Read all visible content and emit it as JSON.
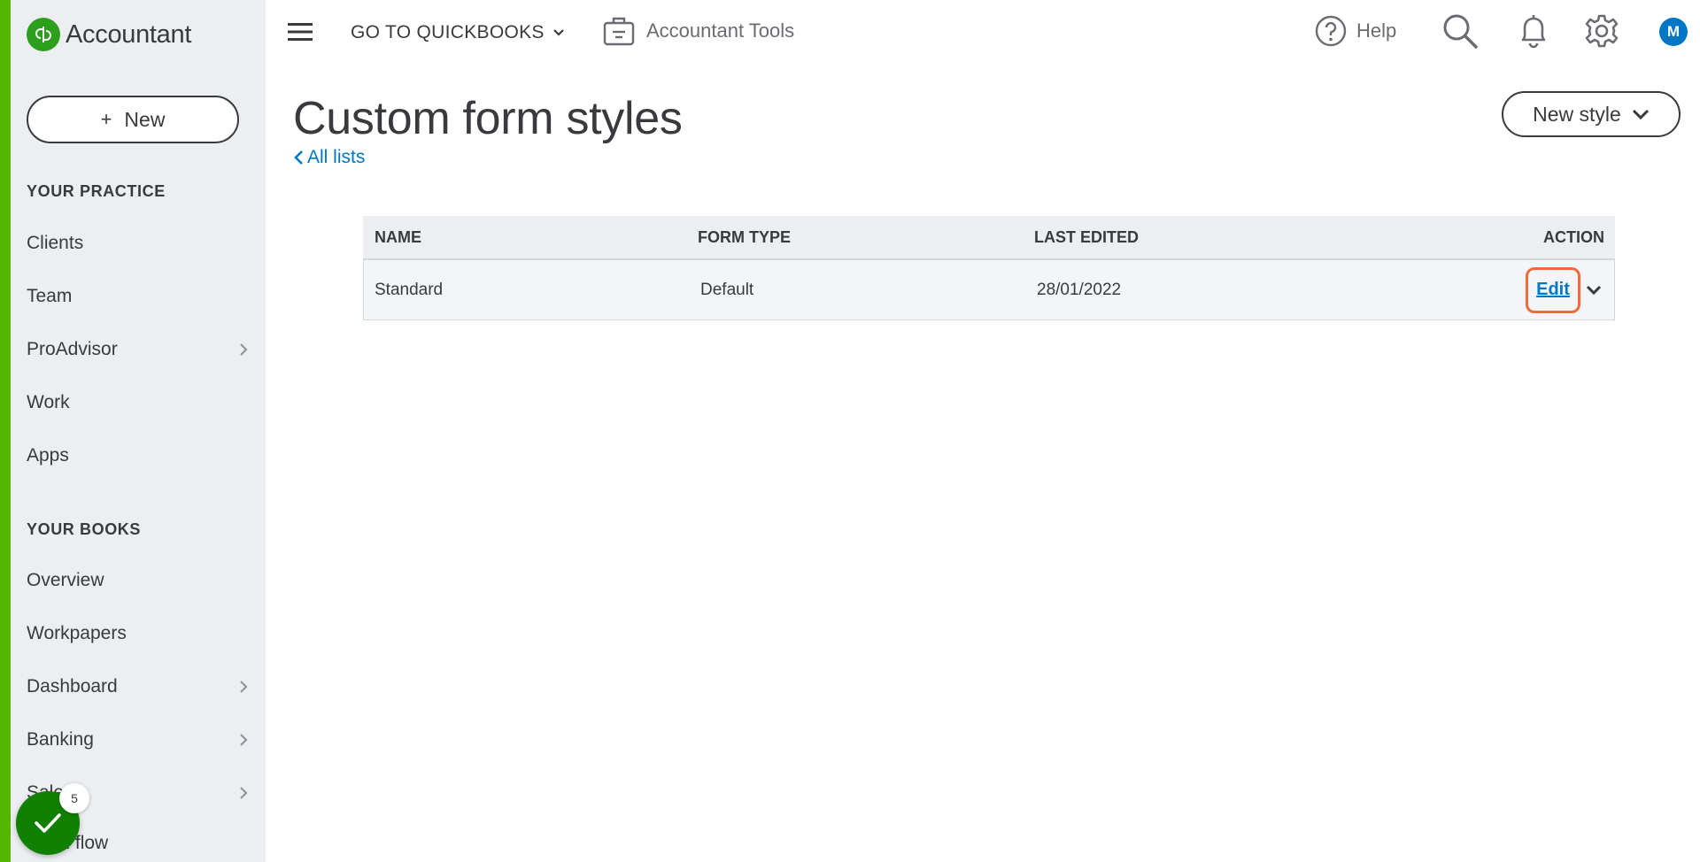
{
  "sidebar": {
    "brand": "Accountant",
    "new_button": "New",
    "practice_label": "YOUR PRACTICE",
    "practice_items": [
      {
        "label": "Clients",
        "has_chevron": false
      },
      {
        "label": "Team",
        "has_chevron": false
      },
      {
        "label": "ProAdvisor",
        "has_chevron": true
      },
      {
        "label": "Work",
        "has_chevron": false
      },
      {
        "label": "Apps",
        "has_chevron": false
      }
    ],
    "books_label": "YOUR BOOKS",
    "books_items": [
      {
        "label": "Overview",
        "has_chevron": false
      },
      {
        "label": "Workpapers",
        "has_chevron": false
      },
      {
        "label": "Dashboard",
        "has_chevron": true
      },
      {
        "label": "Banking",
        "has_chevron": true
      },
      {
        "label": "Sales",
        "has_chevron": true
      },
      {
        "label": "Cash flow",
        "has_chevron": false
      }
    ],
    "task_badge_count": "5"
  },
  "topbar": {
    "goto_label": "GO TO QUICKBOOKS",
    "accountant_tools": "Accountant Tools",
    "help": "Help",
    "avatar_initial": "M"
  },
  "main": {
    "title": "Custom form styles",
    "back_link": "All lists",
    "new_style_button": "New style",
    "table": {
      "headers": {
        "name": "NAME",
        "form_type": "FORM TYPE",
        "last_edited": "LAST EDITED",
        "action": "ACTION"
      },
      "rows": [
        {
          "name": "Standard",
          "form_type": "Default",
          "last_edited": "28/01/2022",
          "action": "Edit"
        }
      ]
    }
  },
  "colors": {
    "sidebar_bg": "#eceef1",
    "accent_green": "#53b700",
    "link_blue": "#0077c5",
    "highlight_orange": "#f06a3b",
    "fab_green": "#108000"
  }
}
